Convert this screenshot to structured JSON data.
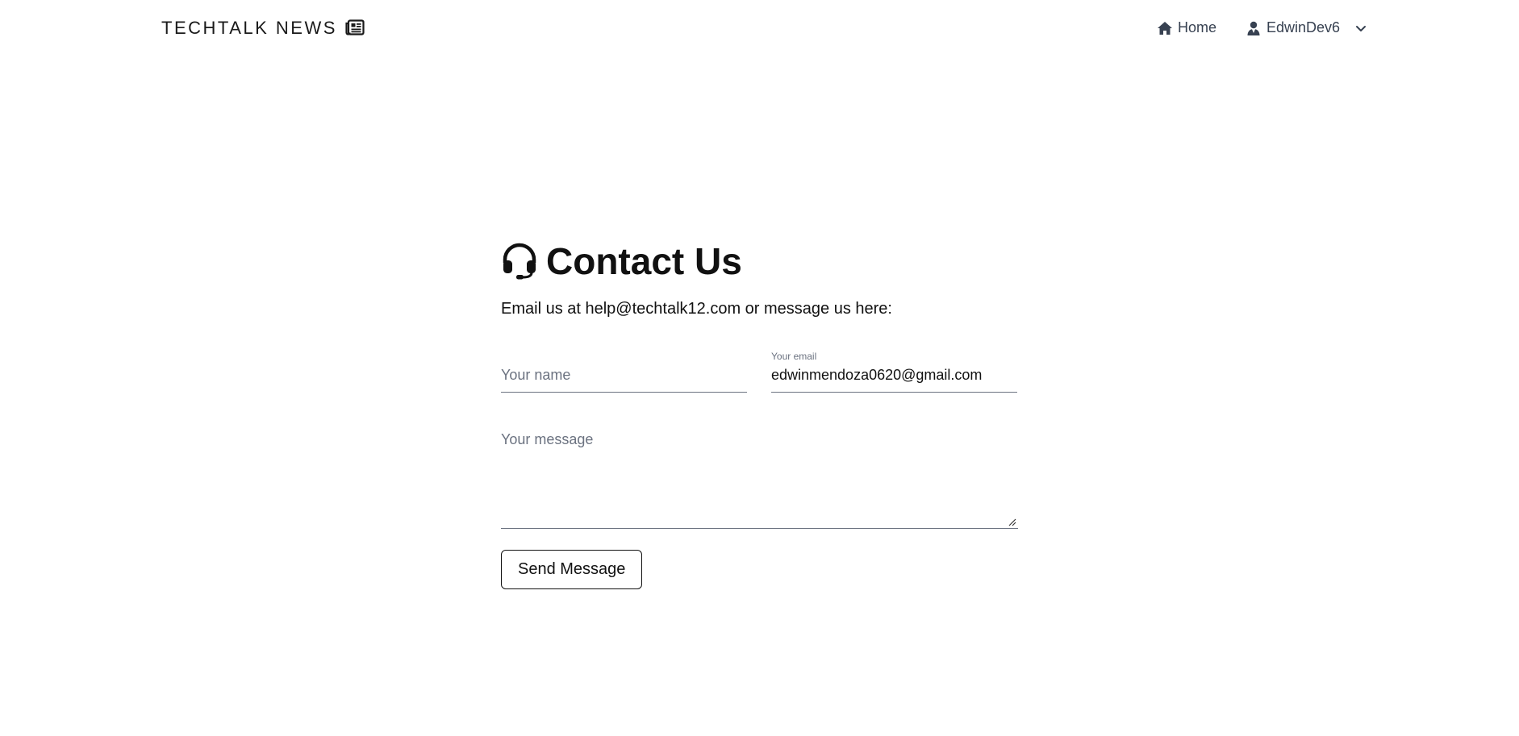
{
  "brand": {
    "name": "TECHTALK NEWS",
    "icon": "newspaper-icon"
  },
  "nav": {
    "home_label": "Home",
    "home_icon": "house-icon",
    "user_label": "EdwinDev6",
    "user_icon": "user-tie-icon",
    "dropdown_icon": "chevron-down-icon"
  },
  "contact": {
    "icon": "headset-icon",
    "title": "Contact Us",
    "intro": "Email us at help@techtalk12.com or message us here:",
    "name_placeholder": "Your name",
    "email_label": "Your email",
    "email_value": "edwinmendoza0620@gmail.com",
    "message_placeholder": "Your message",
    "send_label": "Send Message"
  }
}
